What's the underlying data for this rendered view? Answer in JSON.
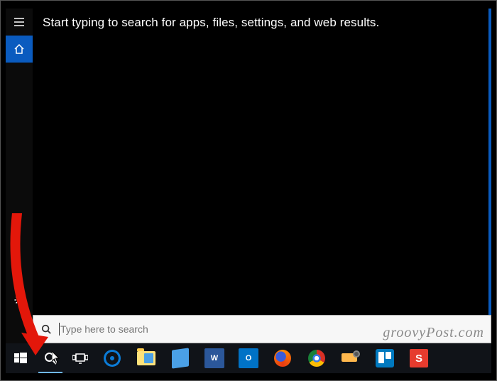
{
  "panel": {
    "prompt": "Start typing to search for apps, files, settings, and web results.",
    "sidebar": {
      "menu_icon": "hamburger-icon",
      "home_icon": "home-icon",
      "settings_icon": "gear-icon"
    }
  },
  "search": {
    "icon": "search-icon",
    "placeholder": "Type here to search",
    "value": ""
  },
  "taskbar": {
    "start": {
      "icon": "windows-logo-icon"
    },
    "cortana": {
      "icon": "search-icon"
    },
    "taskview": {
      "icon": "task-view-icon"
    },
    "apps": [
      {
        "name": "edge",
        "icon": "edge-icon"
      },
      {
        "name": "explorer",
        "icon": "folder-icon"
      },
      {
        "name": "notepad",
        "icon": "notepad-icon"
      },
      {
        "name": "word",
        "icon": "word-icon",
        "letter": "W",
        "color": "#2b579a"
      },
      {
        "name": "outlook",
        "icon": "outlook-icon",
        "letter": "O",
        "color": "#0072c6"
      },
      {
        "name": "firefox",
        "icon": "firefox-icon"
      },
      {
        "name": "chrome",
        "icon": "chrome-icon"
      },
      {
        "name": "moviemaker",
        "icon": "moviemaker-icon"
      },
      {
        "name": "trello",
        "icon": "trello-icon"
      },
      {
        "name": "snagit",
        "icon": "snagit-icon",
        "letter": "S"
      }
    ]
  },
  "watermark": "groovyPost.com",
  "annotation": {
    "arrow_color": "#e3170a"
  }
}
